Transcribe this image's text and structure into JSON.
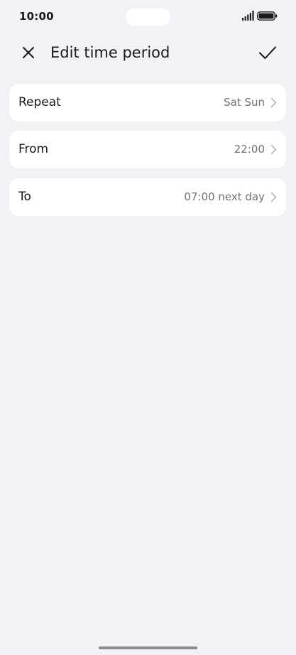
{
  "status_bar": {
    "time": "10:00"
  },
  "header": {
    "title": "Edit time period",
    "close_icon": "close-icon",
    "confirm_icon": "check-icon"
  },
  "settings": [
    {
      "label": "Repeat",
      "value": "Sat Sun"
    },
    {
      "label": "From",
      "value": "22:00"
    },
    {
      "label": "To",
      "value": "07:00 next day"
    }
  ],
  "colors": {
    "background": "#f1f2f5",
    "card": "#ffffff",
    "secondary_text": "#6f7176"
  }
}
